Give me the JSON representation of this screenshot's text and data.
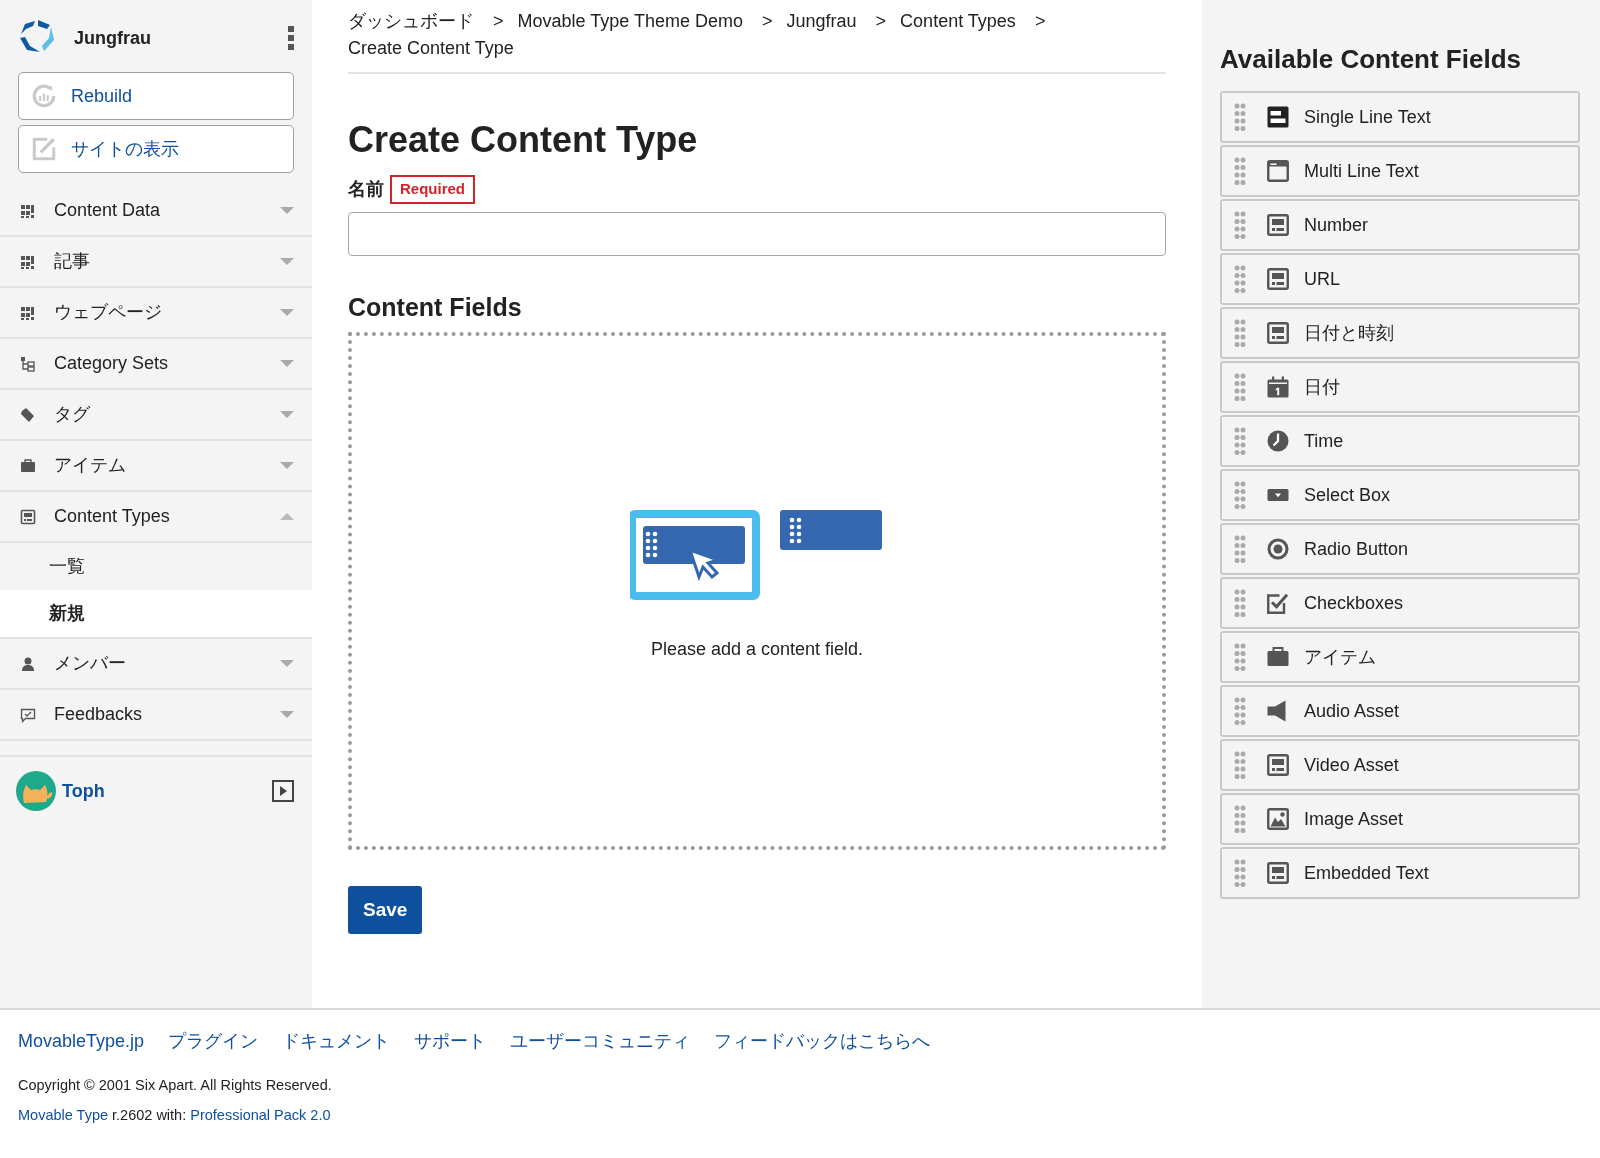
{
  "sidebar": {
    "site_name": "Jungfrau",
    "buttons": [
      {
        "label": "Rebuild",
        "kind": "rebuild"
      },
      {
        "label": "サイトの表示",
        "kind": "external"
      }
    ],
    "nav": [
      {
        "label": "Content Data",
        "kind": "grid",
        "expanded": false
      },
      {
        "label": "記事",
        "kind": "grid",
        "expanded": false
      },
      {
        "label": "ウェブページ",
        "kind": "grid",
        "expanded": false
      },
      {
        "label": "Category Sets",
        "kind": "tree",
        "expanded": false
      },
      {
        "label": "タグ",
        "kind": "tag",
        "expanded": false
      },
      {
        "label": "アイテム",
        "kind": "briefcase",
        "expanded": false
      },
      {
        "label": "Content Types",
        "kind": "form",
        "expanded": true,
        "children": [
          {
            "label": "一覧",
            "selected": false
          },
          {
            "label": "新規",
            "selected": true
          }
        ]
      },
      {
        "label": "メンバー",
        "kind": "person",
        "expanded": false
      },
      {
        "label": "Feedbacks",
        "kind": "comment",
        "expanded": false
      }
    ],
    "user": {
      "name": "Toph"
    }
  },
  "breadcrumb": {
    "separator": ">",
    "items": [
      "ダッシュボード",
      "Movable Type Theme Demo",
      "Jungfrau",
      "Content Types",
      "Create Content Type"
    ]
  },
  "page_title": "Create Content Type",
  "name_field": {
    "label": "名前",
    "badge": "Required"
  },
  "content_fields": {
    "heading": "Content Fields",
    "empty_message": "Please add a content field."
  },
  "save_button": "Save",
  "available_fields": {
    "title": "Available Content Fields",
    "items": [
      {
        "label": "Single Line Text",
        "kind": "single-line"
      },
      {
        "label": "Multi Line Text",
        "kind": "multi-line"
      },
      {
        "label": "Number",
        "kind": "form"
      },
      {
        "label": "URL",
        "kind": "form"
      },
      {
        "label": "日付と時刻",
        "kind": "form"
      },
      {
        "label": "日付",
        "kind": "calendar"
      },
      {
        "label": "Time",
        "kind": "clock"
      },
      {
        "label": "Select Box",
        "kind": "select"
      },
      {
        "label": "Radio Button",
        "kind": "radio"
      },
      {
        "label": "Checkboxes",
        "kind": "checkbox"
      },
      {
        "label": "アイテム",
        "kind": "briefcase"
      },
      {
        "label": "Audio Asset",
        "kind": "speaker"
      },
      {
        "label": "Video Asset",
        "kind": "form"
      },
      {
        "label": "Image Asset",
        "kind": "image"
      },
      {
        "label": "Embedded Text",
        "kind": "form"
      }
    ]
  },
  "footer": {
    "links": [
      "MovableType.jp",
      "プラグイン",
      "ドキュメント",
      "サポート",
      "ユーザーコミュニティ",
      "フィードバックはこちらへ"
    ],
    "copyright": "Copyright © 2001 Six Apart. All Rights Reserved.",
    "version": {
      "product_link": "Movable Type",
      "text": "r.2602 with:",
      "pack_link": "Professional Pack 2.0"
    }
  }
}
